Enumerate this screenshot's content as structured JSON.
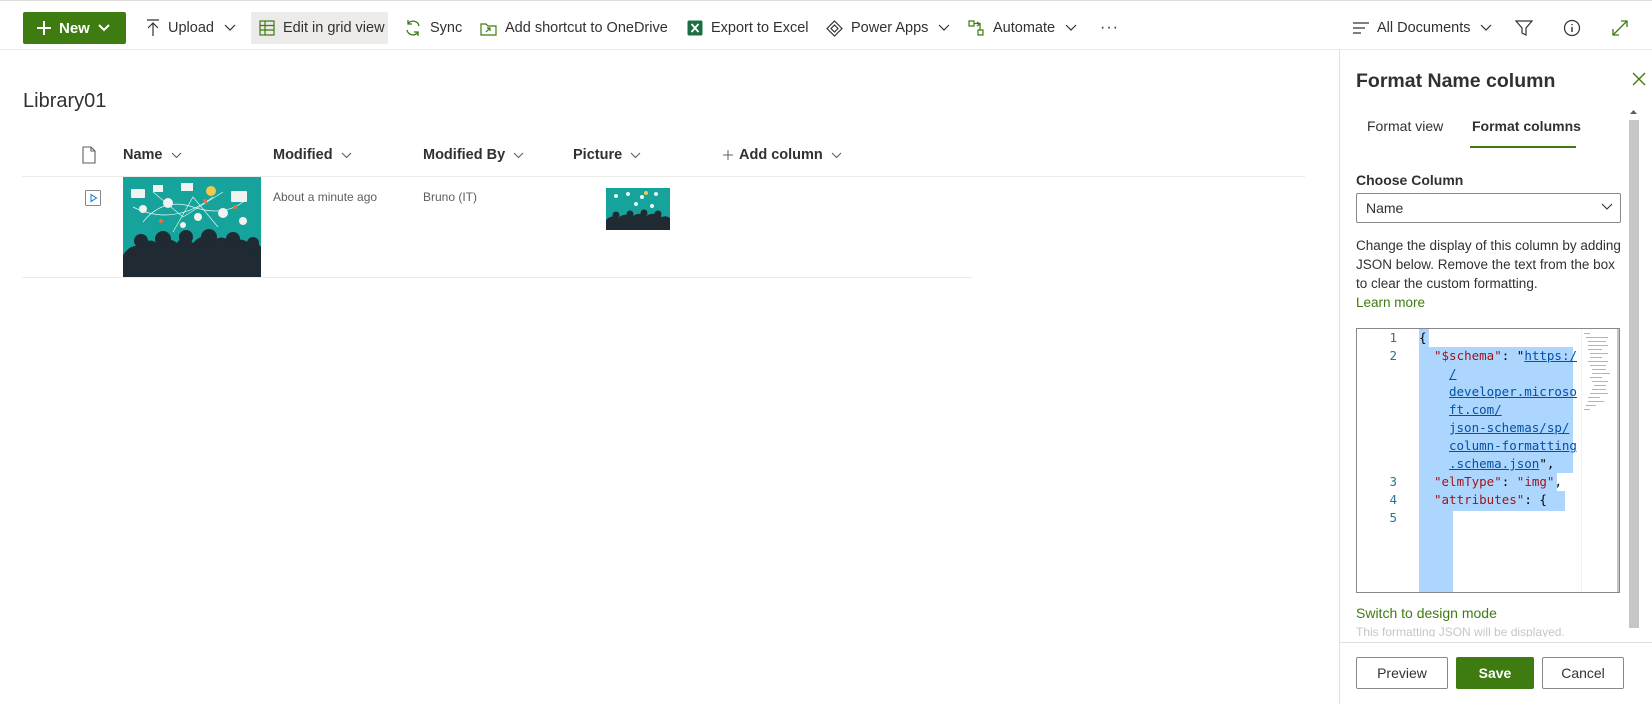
{
  "toolbar": {
    "new_label": "New",
    "upload_label": "Upload",
    "edit_grid_label": "Edit in grid view",
    "sync_label": "Sync",
    "shortcut_label": "Add shortcut to OneDrive",
    "export_label": "Export to Excel",
    "powerapps_label": "Power Apps",
    "automate_label": "Automate",
    "more_label": "···",
    "view_label": "All Documents",
    "accent_color": "#3e7b10"
  },
  "library": {
    "title": "Library01",
    "columns": {
      "name": "Name",
      "modified": "Modified",
      "modified_by": "Modified By",
      "picture": "Picture",
      "add_column": "Add column"
    },
    "rows": [
      {
        "modified": "About a minute ago",
        "modified_by": "Bruno (IT)"
      }
    ]
  },
  "panel": {
    "title": "Format Name column",
    "tabs": [
      "Format view",
      "Format columns"
    ],
    "active_tab": "Format columns",
    "choose_column_label": "Choose Column",
    "selected_column": "Name",
    "description": "Change the display of this column by adding JSON below. Remove the text from the box to clear the custom formatting.",
    "learn_more": "Learn more",
    "code_lines": {
      "l1": "{",
      "l2_key": "\"$schema\"",
      "l2_url_1": "https:/",
      "l2_url_2": "/",
      "l2_url_3": "developer.microso",
      "l2_url_4": "ft.com/",
      "l2_url_5": "json-schemas/sp/",
      "l2_url_6": "column-formatting",
      "l2_url_7": ".schema.json",
      "l3_key": "\"elmType\"",
      "l3_val": "\"img\"",
      "l4_key": "\"attributes\"",
      "l4_rest": ": {"
    },
    "line_numbers": [
      "1",
      "2",
      "3",
      "4",
      "5"
    ],
    "switch_link": "Switch to design mode",
    "faded_text": "This formatting JSON will be displayed.",
    "buttons": {
      "preview": "Preview",
      "save": "Save",
      "cancel": "Cancel"
    }
  }
}
